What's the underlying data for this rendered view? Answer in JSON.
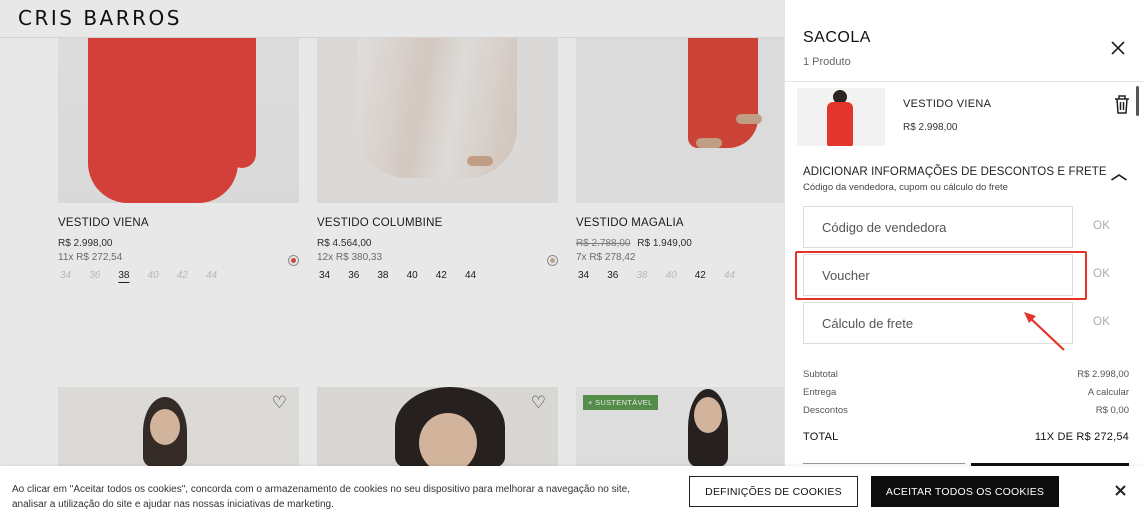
{
  "brand": "CRIS BARROS",
  "products_row1": [
    {
      "name": "VESTIDO VIENA",
      "price": "R$ 2.998,00",
      "installments": "11x R$ 272,54",
      "sizes": [
        "34",
        "36",
        "38",
        "40",
        "42",
        "44"
      ],
      "available": [
        false,
        false,
        true,
        false,
        false,
        false
      ],
      "selected": "38",
      "swatch": "#d9534f"
    },
    {
      "name": "VESTIDO COLUMBINE",
      "price": "R$ 4.564,00",
      "installments": "12x R$ 380,33",
      "sizes": [
        "34",
        "36",
        "38",
        "40",
        "42",
        "44"
      ],
      "available": [
        true,
        true,
        true,
        true,
        true,
        true
      ],
      "swatch": "#c9b59a"
    },
    {
      "name": "VESTIDO MAGALIA",
      "old_price": "R$ 2.788,00",
      "price": "R$ 1.949,00",
      "installments": "7x R$ 278,42",
      "sizes": [
        "34",
        "36",
        "38",
        "40",
        "42",
        "44"
      ],
      "available": [
        true,
        true,
        false,
        false,
        true,
        false
      ]
    }
  ],
  "badge_sustentavel": "+ SUSTENTÁVEL",
  "cart": {
    "title": "SACOLA",
    "count": "1 Produto",
    "item": {
      "name": "VESTIDO VIENA",
      "price": "R$ 2.998,00"
    },
    "discounts": {
      "title": "ADICIONAR INFORMAÇÕES DE DESCONTOS E FRETE",
      "subtitle": "Código da vendedora, cupom ou cálculo do frete",
      "seller_placeholder": "Código de vendedora",
      "voucher_placeholder": "Voucher",
      "shipping_placeholder": "Cálculo de frete",
      "ok_label": "OK"
    },
    "summary": {
      "subtotal_label": "Subtotal",
      "subtotal_value": "R$ 2.998,00",
      "delivery_label": "Entrega",
      "delivery_value": "A calcular",
      "discounts_label": "Descontos",
      "discounts_value": "R$ 0,00",
      "total_label": "TOTAL",
      "total_value": "11X DE R$ 272,54"
    }
  },
  "cookie": {
    "text": "Ao clicar em \"Aceitar todos os cookies\", concorda com o armazenamento de cookies no seu dispositivo para melhorar a navegação no site, analisar a utilização do site e ajudar nas nossas iniciativas de marketing.",
    "settings_label": "DEFINIÇÕES DE COOKIES",
    "accept_label": "ACEITAR TODOS OS COOKIES"
  },
  "colors": {
    "highlight": "#e4342a",
    "accept_button": "#0d0d0d"
  }
}
